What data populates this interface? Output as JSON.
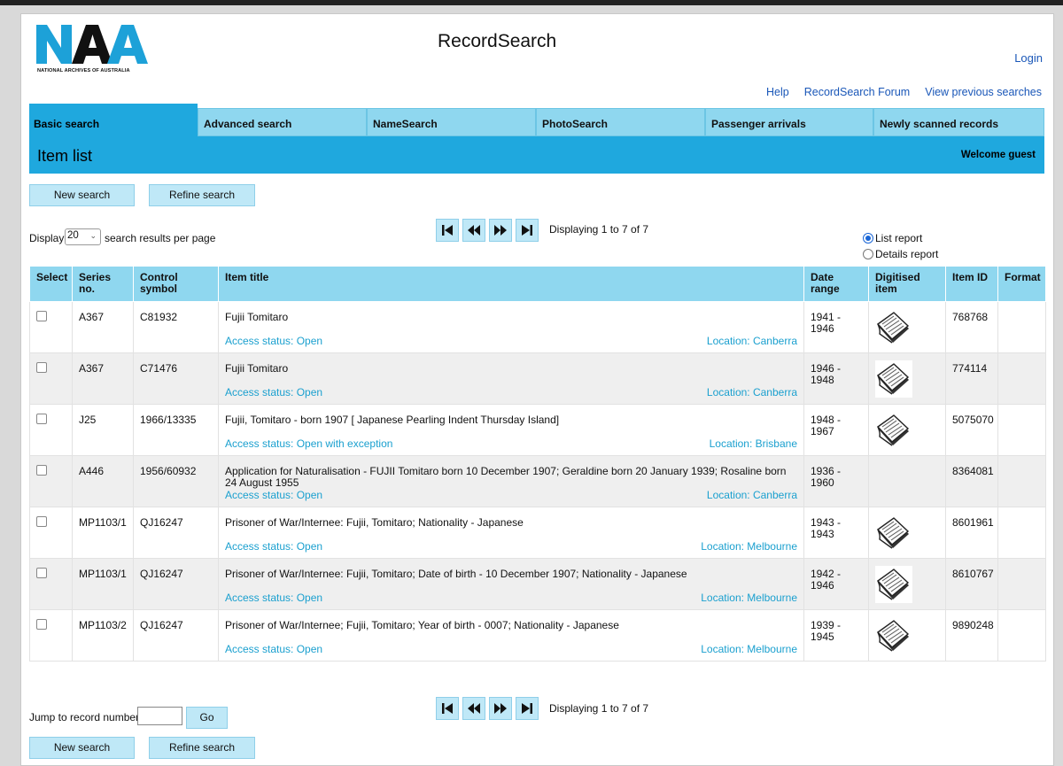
{
  "header": {
    "logo_letters": "NAA",
    "logo_caption": "NATIONAL ARCHIVES OF AUSTRALIA",
    "site_title": "RecordSearch",
    "login": "Login",
    "util_links": [
      "Help",
      "RecordSearch Forum",
      "View previous searches"
    ]
  },
  "tabs": [
    {
      "label": "Basic search",
      "active": true
    },
    {
      "label": "Advanced search",
      "active": false
    },
    {
      "label": "NameSearch",
      "active": false
    },
    {
      "label": "PhotoSearch",
      "active": false
    },
    {
      "label": "Passenger arrivals",
      "active": false
    },
    {
      "label": "Newly scanned records",
      "active": false
    }
  ],
  "banner": {
    "heading": "Item list",
    "welcome": "Welcome guest"
  },
  "actions": {
    "new_search": "New search",
    "refine_search": "Refine search"
  },
  "display": {
    "prefix": "Display",
    "value": "20",
    "suffix": "search results per page"
  },
  "pager": {
    "status": "Displaying 1 to 7 of 7",
    "buttons": [
      "first-page-icon",
      "previous-page-icon",
      "next-page-icon",
      "last-page-icon"
    ]
  },
  "report": {
    "list": "List report",
    "details": "Details report",
    "selected": "list"
  },
  "table": {
    "headers": {
      "select": "Select",
      "series": [
        "Series",
        "no."
      ],
      "control": [
        "Control",
        "symbol"
      ],
      "title": "Item title",
      "date": [
        "Date",
        "range"
      ],
      "digitised": [
        "Digitised",
        "item"
      ],
      "item_id": "Item ID",
      "format": "Format"
    },
    "rows": [
      {
        "series": "A367",
        "control": "C81932",
        "title": "Fujii Tomitaro",
        "access": "Access status: Open",
        "location": "Location: Canberra",
        "date1": "1941 -",
        "date2": "1946",
        "digitised": true,
        "item_id": "768768",
        "format": ""
      },
      {
        "series": "A367",
        "control": "C71476",
        "title": "Fujii Tomitaro",
        "access": "Access status: Open",
        "location": "Location: Canberra",
        "date1": "1946 -",
        "date2": "1948",
        "digitised": true,
        "item_id": "774114",
        "format": ""
      },
      {
        "series": "J25",
        "control": "1966/13335",
        "title": "Fujii, Tomitaro - born 1907 [ Japanese Pearling Indent Thursday Island]",
        "access": "Access status: Open with exception",
        "location": "Location: Brisbane",
        "date1": "1948 -",
        "date2": "1967",
        "digitised": true,
        "item_id": "5075070",
        "format": ""
      },
      {
        "series": "A446",
        "control": "1956/60932",
        "title": "Application for Naturalisation - FUJII Tomitaro born 10 December 1907; Geraldine born 20 January 1939; Rosaline born 24 August 1955",
        "access": "Access status: Open",
        "location": "Location: Canberra",
        "date1": "1936 -",
        "date2": "1960",
        "digitised": false,
        "item_id": "8364081",
        "format": ""
      },
      {
        "series": "MP1103/1",
        "control": "QJ16247",
        "title": "Prisoner of War/Internee: Fujii, Tomitaro; Nationality - Japanese",
        "access": "Access status: Open",
        "location": "Location: Melbourne",
        "date1": "1943 -",
        "date2": "1943",
        "digitised": true,
        "item_id": "8601961",
        "format": ""
      },
      {
        "series": "MP1103/1",
        "control": "QJ16247",
        "title": "Prisoner of War/Internee: Fujii, Tomitaro; Date of birth - 10 December 1907; Nationality - Japanese",
        "access": "Access status: Open",
        "location": "Location: Melbourne",
        "date1": "1942 -",
        "date2": "1946",
        "digitised": true,
        "item_id": "8610767",
        "format": ""
      },
      {
        "series": "MP1103/2",
        "control": "QJ16247",
        "title": "Prisoner of War/Internee; Fujii, Tomitaro; Year of birth - 0007; Nationality - Japanese",
        "access": "Access status: Open",
        "location": "Location: Melbourne",
        "date1": "1939 -",
        "date2": "1945",
        "digitised": true,
        "item_id": "9890248",
        "format": ""
      }
    ]
  },
  "jump": {
    "label": "Jump to record number",
    "value": "",
    "go": "Go"
  },
  "colors": {
    "accent": "#1fa8de",
    "tab": "#8fd7ef",
    "button": "#bfe8f7",
    "link": "#1a57b8",
    "meta_link": "#1ba0cf",
    "logo_blue": "#1da1d8"
  }
}
